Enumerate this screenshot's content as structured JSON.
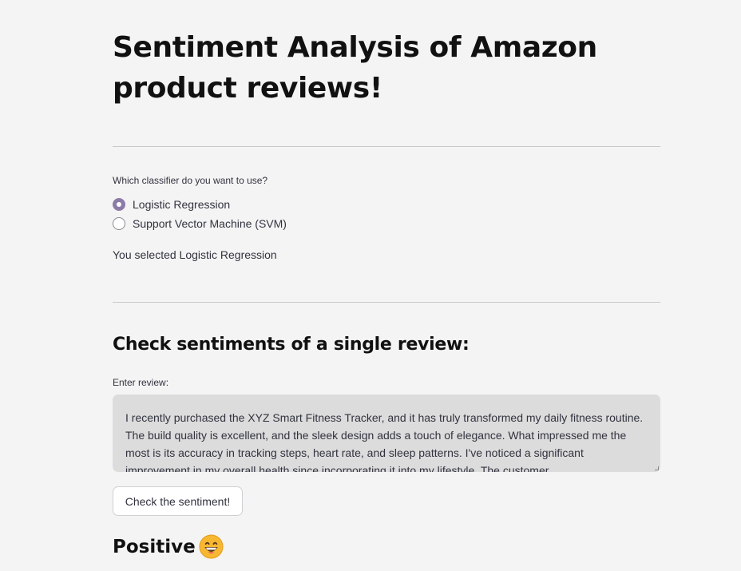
{
  "page": {
    "title": "Sentiment Analysis of Amazon product reviews!"
  },
  "classifier": {
    "label": "Which classifier do you want to use?",
    "options": [
      {
        "label": "Logistic Regression",
        "selected": true
      },
      {
        "label": "Support Vector Machine (SVM)",
        "selected": false
      }
    ],
    "selected_text": "You selected Logistic Regression"
  },
  "single_review": {
    "header": "Check sentiments of a single review:",
    "input_label": "Enter review:",
    "review_text": "I recently purchased the XYZ Smart Fitness Tracker, and it has truly transformed my daily fitness routine. The build quality is excellent, and the sleek design adds a touch of elegance. What impressed me the most is its accuracy in tracking steps, heart rate, and sleep patterns. I've noticed a significant improvement in my overall health since incorporating it into my lifestyle. The customer",
    "button_label": "Check the sentiment!",
    "result_label": "Positive",
    "result_icon": "grinning-face-icon"
  },
  "colors": {
    "background": "#f4f4f4",
    "radio_accent": "#8c7ba6",
    "textarea_bg": "#dcdcdc",
    "emoji_yellow": "#f7b731"
  }
}
